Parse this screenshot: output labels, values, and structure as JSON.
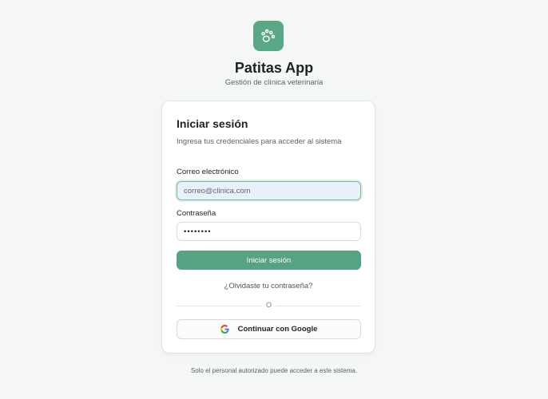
{
  "app": {
    "title": "Patitas App",
    "subtitle": "Gestión de clínica veterinaria",
    "logo_icon": "paw-icon",
    "accent_color": "#5aa883"
  },
  "login": {
    "title": "Iniciar sesión",
    "description": "Ingresa tus credenciales para acceder al sistema",
    "email_label": "Correo electrónico",
    "email_placeholder": "correo@clinica.com",
    "email_value": "",
    "password_label": "Contraseña",
    "password_value": "••••••••",
    "submit_label": "Iniciar sesión",
    "forgot_label": "¿Olvidaste tu contraseña?",
    "divider_label": "O",
    "google_label": "Continuar con Google",
    "google_icon": "google-icon"
  },
  "footer": {
    "note": "Solo el personal autorizado puede acceder a este sistema."
  }
}
